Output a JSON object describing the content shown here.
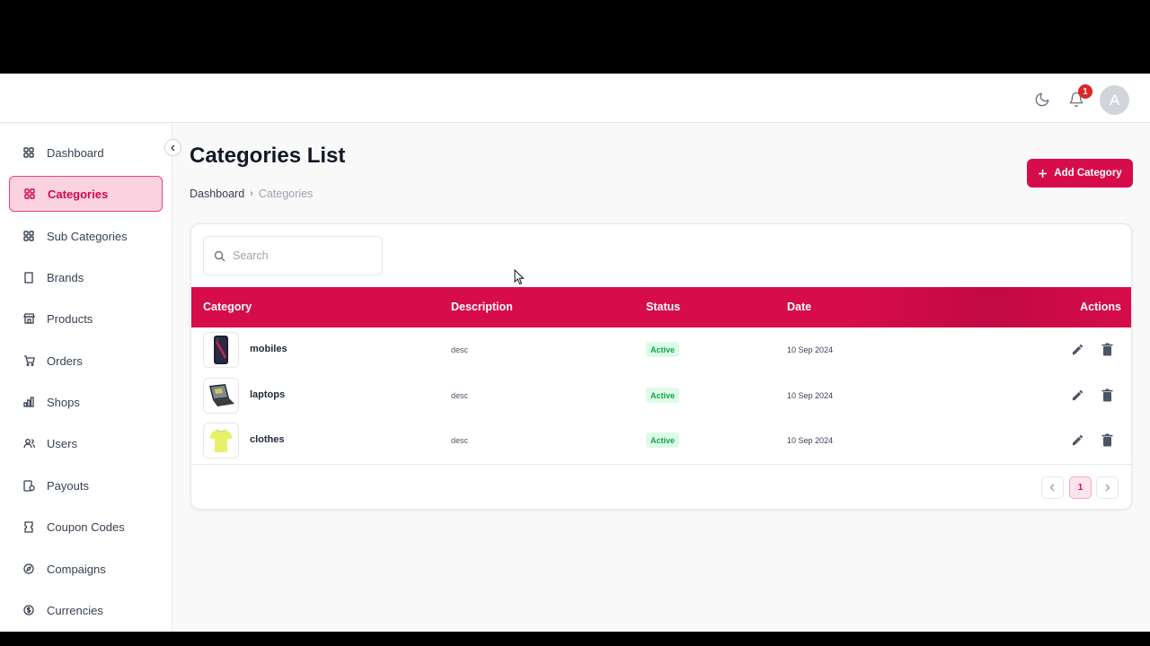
{
  "header": {
    "notifications_count": "1",
    "avatar_initial": "A",
    "icons": [
      "moon-icon",
      "bell-icon"
    ]
  },
  "sidebar": {
    "items": [
      {
        "label": "Dashboard",
        "icon": "grid-icon",
        "active": false
      },
      {
        "label": "Categories",
        "icon": "grid-icon",
        "active": true
      },
      {
        "label": "Sub Categories",
        "icon": "grid-icon",
        "active": false
      },
      {
        "label": "Brands",
        "icon": "building-icon",
        "active": false
      },
      {
        "label": "Products",
        "icon": "store-icon",
        "active": false
      },
      {
        "label": "Orders",
        "icon": "cart-icon",
        "active": false
      },
      {
        "label": "Shops",
        "icon": "chart-icon",
        "active": false
      },
      {
        "label": "Users",
        "icon": "users-icon",
        "active": false
      },
      {
        "label": "Payouts",
        "icon": "payout-icon",
        "active": false
      },
      {
        "label": "Coupon Codes",
        "icon": "coupon-icon",
        "active": false
      },
      {
        "label": "Compaigns",
        "icon": "compass-icon",
        "active": false
      },
      {
        "label": "Currencies",
        "icon": "currency-icon",
        "active": false
      }
    ]
  },
  "main": {
    "title": "Categories List",
    "breadcrumb": {
      "home": "Dashboard",
      "separator": "›",
      "current": "Categories"
    },
    "add_button_label": "Add Category",
    "search_placeholder": "Search",
    "table": {
      "columns": {
        "category": "Category",
        "description": "Description",
        "status": "Status",
        "date": "Date",
        "actions": "Actions"
      },
      "rows": [
        {
          "name": "mobiles",
          "description": "desc",
          "status": "Active",
          "date": "10 Sep 2024",
          "thumb": "phone-image"
        },
        {
          "name": "laptops",
          "description": "desc",
          "status": "Active",
          "date": "10 Sep 2024",
          "thumb": "laptop-image"
        },
        {
          "name": "clothes",
          "description": "desc",
          "status": "Active",
          "date": "10 Sep 2024",
          "thumb": "tshirt-image"
        }
      ]
    },
    "pagination": {
      "current_page": "1"
    }
  },
  "colors": {
    "accent": "#d70c4b",
    "active_bg": "#fbd3e0",
    "status_bg": "#dcfce7",
    "status_text": "#16a34a"
  }
}
